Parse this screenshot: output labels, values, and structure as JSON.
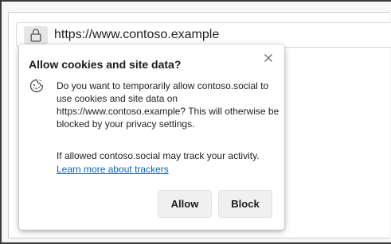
{
  "browser": {
    "url": "https://www.contoso.example",
    "lock_icon": "lock-icon"
  },
  "popup": {
    "title": "Allow cookies and site data?",
    "close_icon": "close-icon",
    "cookie_icon": "cookie-icon",
    "body": "Do you want to temporarily allow contoso.social to use cookies and site data on https://www.contoso.example? This will otherwise be blocked by your privacy settings.",
    "tracking_note": "If allowed contoso.social may track your activity.",
    "learn_more_link": "Learn more about trackers",
    "allow_label": "Allow",
    "block_label": "Block"
  },
  "colors": {
    "link": "#0f62b3",
    "button_bg": "#f0f0f0",
    "text": "#1f1f1f"
  }
}
